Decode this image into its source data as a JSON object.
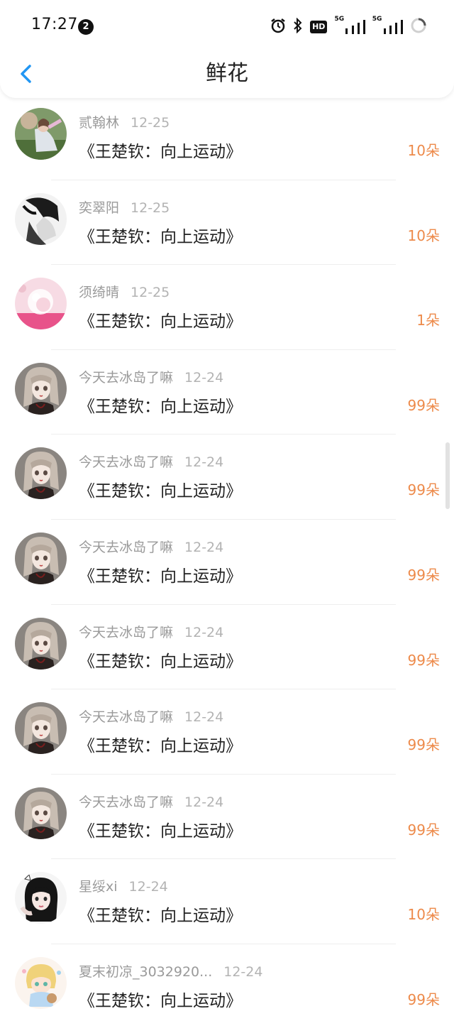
{
  "status_bar": {
    "time": "17:27",
    "notification_count": "2",
    "hd_label": "HD",
    "signal1_label": "5G",
    "signal2_label": "5G"
  },
  "header": {
    "title": "鲜花"
  },
  "list": [
    {
      "name": "贰翰林",
      "date": "12-25",
      "gift": "《王楚钦：向上运动》",
      "count": "10朵",
      "avatar": "girl-on-grass"
    },
    {
      "name": "奕翠阳",
      "date": "12-25",
      "gift": "《王楚钦：向上运动》",
      "count": "10朵",
      "avatar": "dark-haired-boy"
    },
    {
      "name": "须绮晴",
      "date": "12-25",
      "gift": "《王楚钦：向上运动》",
      "count": "1朵",
      "avatar": "pink-ball"
    },
    {
      "name": "今天去冰岛了嘛",
      "date": "12-24",
      "gift": "《王楚钦：向上运动》",
      "count": "99朵",
      "avatar": "anime-girl"
    },
    {
      "name": "今天去冰岛了嘛",
      "date": "12-24",
      "gift": "《王楚钦：向上运动》",
      "count": "99朵",
      "avatar": "anime-girl"
    },
    {
      "name": "今天去冰岛了嘛",
      "date": "12-24",
      "gift": "《王楚钦：向上运动》",
      "count": "99朵",
      "avatar": "anime-girl"
    },
    {
      "name": "今天去冰岛了嘛",
      "date": "12-24",
      "gift": "《王楚钦：向上运动》",
      "count": "99朵",
      "avatar": "anime-girl"
    },
    {
      "name": "今天去冰岛了嘛",
      "date": "12-24",
      "gift": "《王楚钦：向上运动》",
      "count": "99朵",
      "avatar": "anime-girl"
    },
    {
      "name": "今天去冰岛了嘛",
      "date": "12-24",
      "gift": "《王楚钦：向上运动》",
      "count": "99朵",
      "avatar": "anime-girl"
    },
    {
      "name": "星绥xi",
      "date": "12-24",
      "gift": "《王楚钦：向上运动》",
      "count": "10朵",
      "avatar": "dark-haired-girl"
    },
    {
      "name": "夏末初凉_3032920...",
      "date": "12-24",
      "gift": "《王楚钦：向上运动》",
      "count": "99朵",
      "avatar": "blonde-chibi"
    }
  ],
  "colors": {
    "accent_blue": "#2196f3",
    "count_orange": "#ed8a4a",
    "meta_gray": "#9a9a9a"
  }
}
